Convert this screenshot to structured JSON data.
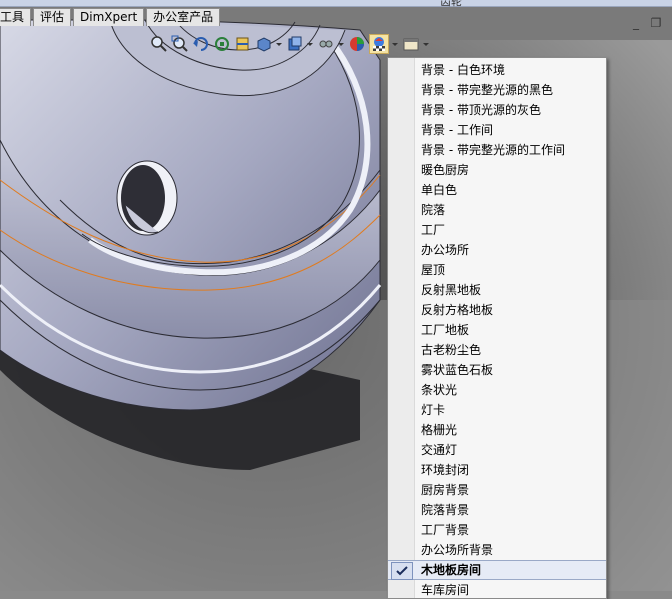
{
  "window": {
    "title": "齿轮"
  },
  "tabs": [
    {
      "label": "工具"
    },
    {
      "label": "评估"
    },
    {
      "label": "DimXpert"
    },
    {
      "label": "办公室产品"
    }
  ],
  "toolbar": {
    "icons": [
      "zoom-to-fit-icon",
      "zoom-area-icon",
      "rotate-icon",
      "previous-view-icon",
      "section-view-icon",
      "view-orientation-icon",
      "display-style-icon",
      "hide-show-icon",
      "edit-appearance-icon",
      "apply-scene-icon",
      "view-settings-icon"
    ]
  },
  "scene_menu": {
    "items": [
      {
        "label": "背景 - 白色环境"
      },
      {
        "label": "背景 - 带完整光源的黑色"
      },
      {
        "label": "背景 - 带顶光源的灰色"
      },
      {
        "label": "背景 - 工作间"
      },
      {
        "label": "背景 - 带完整光源的工作间"
      },
      {
        "label": "暖色厨房"
      },
      {
        "label": "单白色"
      },
      {
        "label": "院落"
      },
      {
        "label": "工厂"
      },
      {
        "label": "办公场所"
      },
      {
        "label": "屋顶"
      },
      {
        "label": "反射黑地板"
      },
      {
        "label": "反射方格地板"
      },
      {
        "label": "工厂地板"
      },
      {
        "label": "古老粉尘色"
      },
      {
        "label": "雾状蓝色石板"
      },
      {
        "label": "条状光"
      },
      {
        "label": "灯卡"
      },
      {
        "label": "格栅光"
      },
      {
        "label": "交通灯"
      },
      {
        "label": "环境封闭"
      },
      {
        "label": "厨房背景"
      },
      {
        "label": "院落背景"
      },
      {
        "label": "工厂背景"
      },
      {
        "label": "办公场所背景"
      },
      {
        "label": "木地板房间"
      },
      {
        "label": "车库房间"
      }
    ],
    "checked_label": "木地板房间"
  }
}
